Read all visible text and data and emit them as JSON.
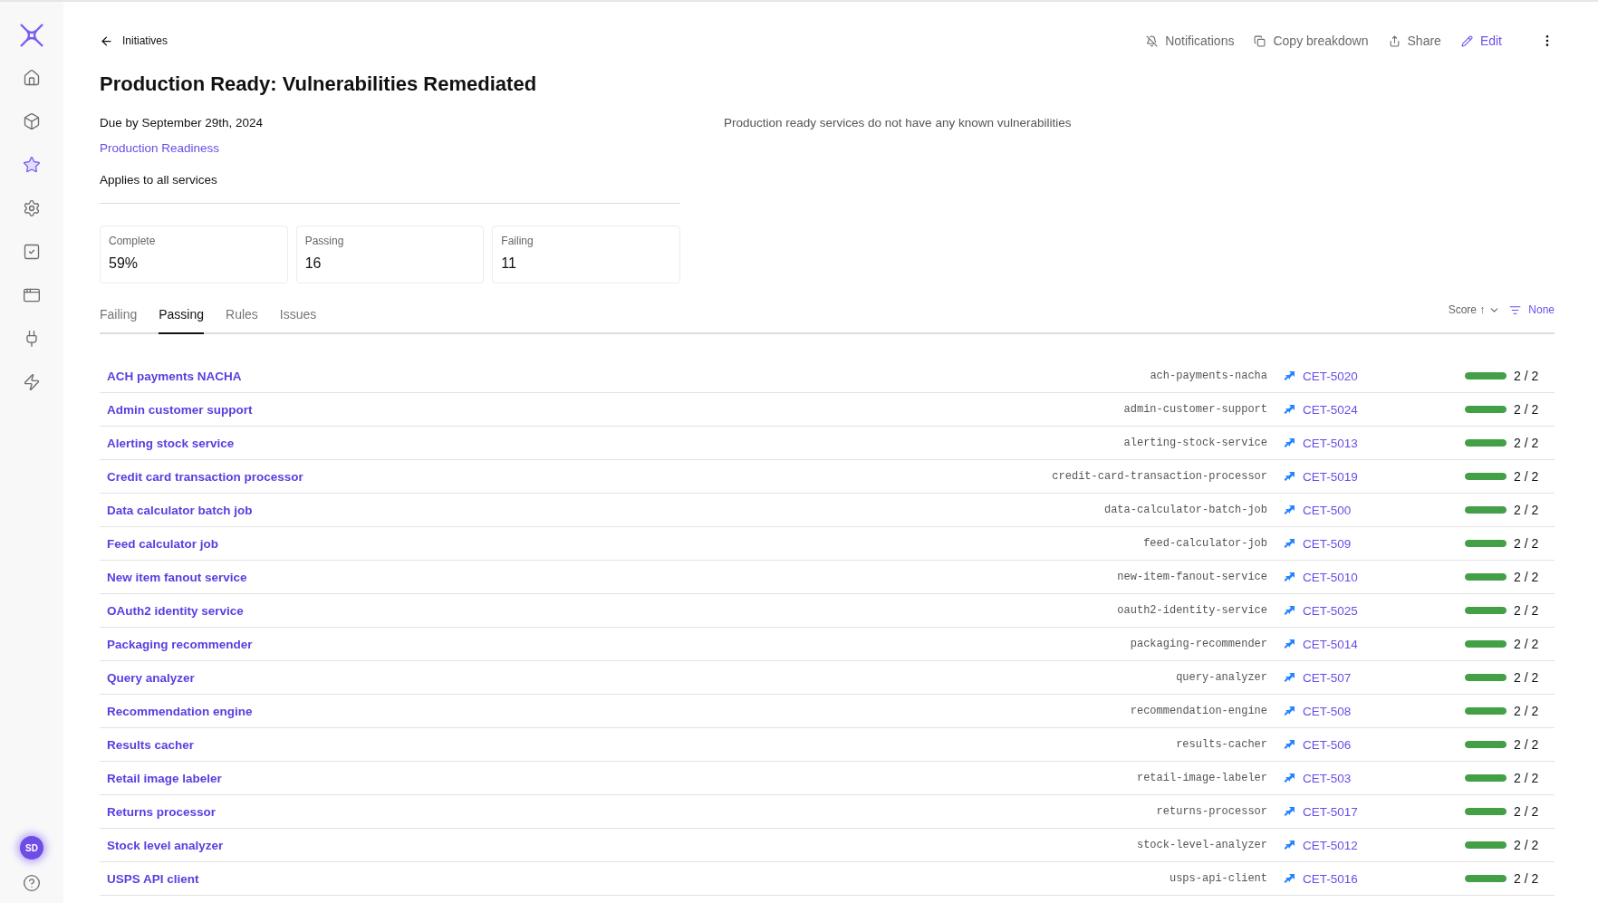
{
  "back_link": "Initiatives",
  "header_actions": [
    {
      "kind": "notifications",
      "label": "Notifications"
    },
    {
      "kind": "copy",
      "label": "Copy breakdown"
    },
    {
      "kind": "share",
      "label": "Share"
    },
    {
      "kind": "edit",
      "label": "Edit"
    }
  ],
  "sidebar": {
    "items": [
      {
        "kind": "home",
        "selected": false
      },
      {
        "kind": "cube",
        "selected": false
      },
      {
        "kind": "star",
        "selected": true
      },
      {
        "kind": "gear",
        "selected": false
      },
      {
        "kind": "check",
        "selected": false
      },
      {
        "kind": "window",
        "selected": false
      },
      {
        "kind": "plug",
        "selected": false
      },
      {
        "kind": "bolt",
        "selected": false
      }
    ],
    "avatar": "SD"
  },
  "title": "Production Ready: Vulnerabilities Remediated",
  "due": "Due by September 29th, 2024",
  "scorecard_link": "Production Readiness",
  "applies_to": "Applies to all services",
  "description": "Production ready services do not have any known vulnerabilities",
  "stats": [
    {
      "label": "Complete",
      "value": "59%"
    },
    {
      "label": "Passing",
      "value": "16"
    },
    {
      "label": "Failing",
      "value": "11"
    }
  ],
  "tabs": [
    {
      "label": "Failing",
      "selected": false
    },
    {
      "label": "Passing",
      "selected": true
    },
    {
      "label": "Rules",
      "selected": false
    },
    {
      "label": "Issues",
      "selected": false
    }
  ],
  "sort": {
    "label": "Score ↑",
    "filter": "None"
  },
  "rows": [
    {
      "name": "ACH payments NACHA",
      "slug": "ach-payments-nacha",
      "ticket": "CET-5020",
      "level": 1,
      "score": "2 / 2"
    },
    {
      "name": "Admin customer support",
      "slug": "admin-customer-support",
      "ticket": "CET-5024",
      "level": 1,
      "score": "2 / 2"
    },
    {
      "name": "Alerting stock service",
      "slug": "alerting-stock-service",
      "ticket": "CET-5013",
      "level": 1,
      "score": "2 / 2"
    },
    {
      "name": "Credit card transaction processor",
      "slug": "credit-card-transaction-processor",
      "ticket": "CET-5019",
      "level": 1,
      "score": "2 / 2"
    },
    {
      "name": "Data calculator batch job",
      "slug": "data-calculator-batch-job",
      "ticket": "CET-500",
      "level": 1,
      "score": "2 / 2"
    },
    {
      "name": "Feed calculator job",
      "slug": "feed-calculator-job",
      "ticket": "CET-509",
      "level": 1,
      "score": "2 / 2"
    },
    {
      "name": "New item fanout service",
      "slug": "new-item-fanout-service",
      "ticket": "CET-5010",
      "level": 1,
      "score": "2 / 2"
    },
    {
      "name": "OAuth2 identity service",
      "slug": "oauth2-identity-service",
      "ticket": "CET-5025",
      "level": 1,
      "score": "2 / 2"
    },
    {
      "name": "Packaging recommender",
      "slug": "packaging-recommender",
      "ticket": "CET-5014",
      "level": 1,
      "score": "2 / 2"
    },
    {
      "name": "Query analyzer",
      "slug": "query-analyzer",
      "ticket": "CET-507",
      "level": 1,
      "score": "2 / 2"
    },
    {
      "name": "Recommendation engine",
      "slug": "recommendation-engine",
      "ticket": "CET-508",
      "level": 1,
      "score": "2 / 2"
    },
    {
      "name": "Results cacher",
      "slug": "results-cacher",
      "ticket": "CET-506",
      "level": 1,
      "score": "2 / 2"
    },
    {
      "name": "Retail image labeler",
      "slug": "retail-image-labeler",
      "ticket": "CET-503",
      "level": 1,
      "score": "2 / 2"
    },
    {
      "name": "Returns processor",
      "slug": "returns-processor",
      "ticket": "CET-5017",
      "level": 1,
      "score": "2 / 2"
    },
    {
      "name": "Stock level analyzer",
      "slug": "stock-level-analyzer",
      "ticket": "CET-5012",
      "level": 1,
      "score": "2 / 2"
    },
    {
      "name": "USPS API client",
      "slug": "usps-api-client",
      "ticket": "CET-5016",
      "level": 1,
      "score": "2 / 2"
    }
  ]
}
